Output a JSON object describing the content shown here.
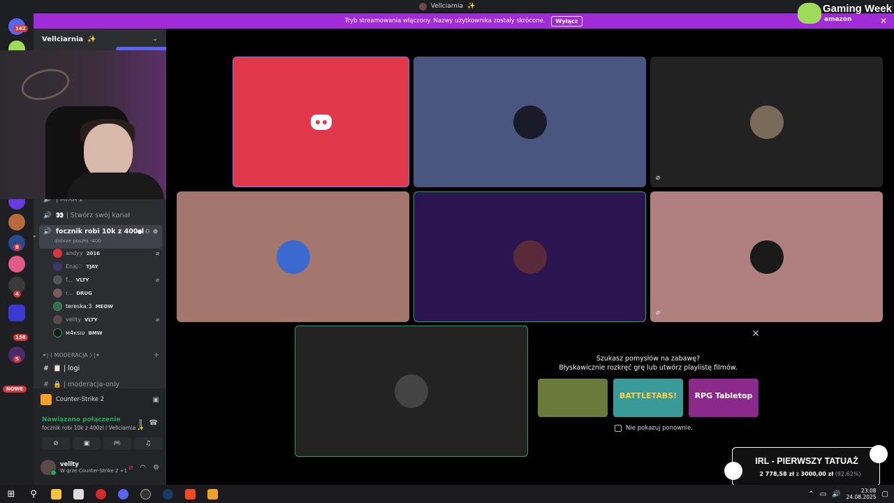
{
  "titlebar": {
    "title": "Vellciarnia",
    "emoji": "✨"
  },
  "banner": {
    "text": "Tryb streamowania włączony. Nazwy użytkownika zostały skrócone.",
    "button": "Wyłącz",
    "close": "✕"
  },
  "overlay_logo": {
    "title": "Gaming Week",
    "brand": "amazon"
  },
  "server_rail": {
    "badges": [
      "142",
      "8",
      "4",
      "138",
      "5"
    ],
    "nowe": "NOWE"
  },
  "server": {
    "name": "Vellciarnia",
    "emoji": "✨",
    "chevron": "⌄"
  },
  "channels": [
    {
      "icon": "🔊",
      "label": "| MIXA 2"
    },
    {
      "icon": "🔊",
      "label": "👀 | Stwórz swój kanał"
    }
  ],
  "active_channel": {
    "icon": "🔊",
    "label": "focznik robi 10k z 400zl",
    "status": "dobrze poszło -400"
  },
  "voice_users": [
    {
      "name": "andyy",
      "tag": "2016",
      "muted": true,
      "color": "#da373c"
    },
    {
      "name": "Enaj♡",
      "tag": "TJAY",
      "muted": false,
      "color": "#3a3a6a"
    },
    {
      "name": "f...",
      "tag": "VLTY",
      "muted": true,
      "color": "#555"
    },
    {
      "name": "r...",
      "tag": "DRUG",
      "muted": false,
      "color": "#7a5a5a"
    },
    {
      "name": "tereska:3",
      "tag": "MEOW",
      "muted": false,
      "color": "#3a6a4a",
      "bright": true
    },
    {
      "name": "vellty",
      "tag": "VLTY",
      "muted": true,
      "color": "#5a4a4a"
    },
    {
      "name": "м4кѕιυ",
      "tag": "BMW",
      "muted": false,
      "color": "#23a55a",
      "bright": true
    }
  ],
  "category": {
    "label": "✶| ( MODERACJA ) |✶",
    "plus": "+"
  },
  "text_channels": [
    {
      "label": "📋 | logi"
    },
    {
      "label": "🔒 | moderacja-only"
    }
  ],
  "game_panel": {
    "game": "Counter-Strike 2",
    "connection": "Nawiązano połączenie",
    "connection_sub": "focznik robi 10k z 400zl / Vellciarnia ✨",
    "user": {
      "name": "vellty",
      "status": "W grze Counter-Strike 2 +1"
    }
  },
  "activity": {
    "close": "✕",
    "question": "Szukasz pomysłów na zabawę?",
    "subtitle": "Błyskawicznie rozkręć grę lub utwórz playlistę filmów.",
    "cards": [
      {
        "label": "",
        "color": "#6a7a3a"
      },
      {
        "label": "BATTLETABS!",
        "color": "#3a9a9a"
      },
      {
        "label": "RPG Tabletop",
        "color": "#8a2a8a"
      }
    ],
    "dont_show": "Nie pokazuj ponownie."
  },
  "donation": {
    "title": "IRL - PIERWSZY TATUAŻ",
    "current": "2 778,58 zł",
    "sep": "z",
    "goal": "3000,00 zł",
    "percent": "(92.62%)"
  },
  "tray": {
    "time": "23:08",
    "date": "24.08.2025"
  },
  "colors": {
    "accent": "#5865f2",
    "banner": "#a22bd8",
    "danger": "#da373c",
    "online": "#23a55a"
  }
}
